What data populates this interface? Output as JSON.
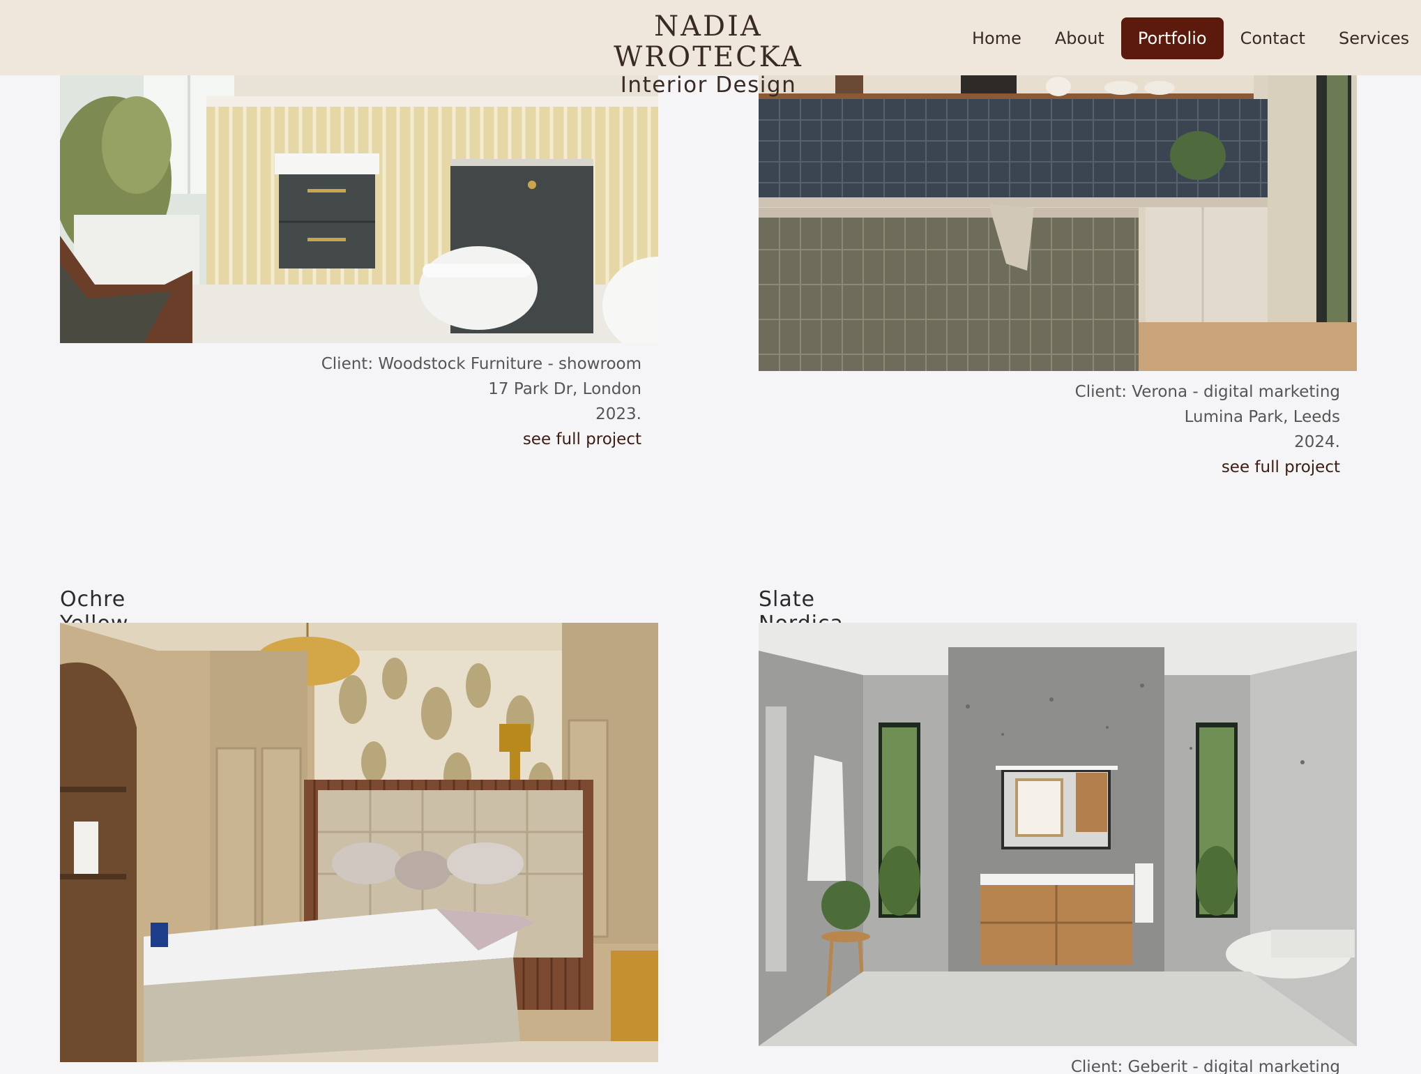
{
  "brand": {
    "name": "NADIA WROTECKA",
    "subtitle": "Interior Design"
  },
  "nav": {
    "items": [
      {
        "label": "Home"
      },
      {
        "label": "About"
      },
      {
        "label": "Portfolio"
      },
      {
        "label": "Contact"
      },
      {
        "label": "Services"
      }
    ],
    "active": "Portfolio",
    "active_color": "#5b1a0c"
  },
  "projects": [
    {
      "title": "",
      "image": "bathroom-icon",
      "client": "Client: Woodstock Furniture - showroom",
      "location": "17 Park Dr, London",
      "year": "2023.",
      "link": "see full project"
    },
    {
      "title": "",
      "image": "kitchen-icon",
      "client": "Client: Verona - digital marketing",
      "location": "Lumina Park, Leeds",
      "year": "2024.",
      "link": "see full project"
    },
    {
      "title": "Ochre Yellow",
      "image": "bedroom-icon"
    },
    {
      "title": "Slate Nordica",
      "image": "bathroom-icon",
      "client": "Client: Geberit - digital marketing"
    }
  ],
  "colors": {
    "header_bg": "#efe6dc",
    "page_bg": "#f5f5f7",
    "accent": "#5b1a0c"
  }
}
